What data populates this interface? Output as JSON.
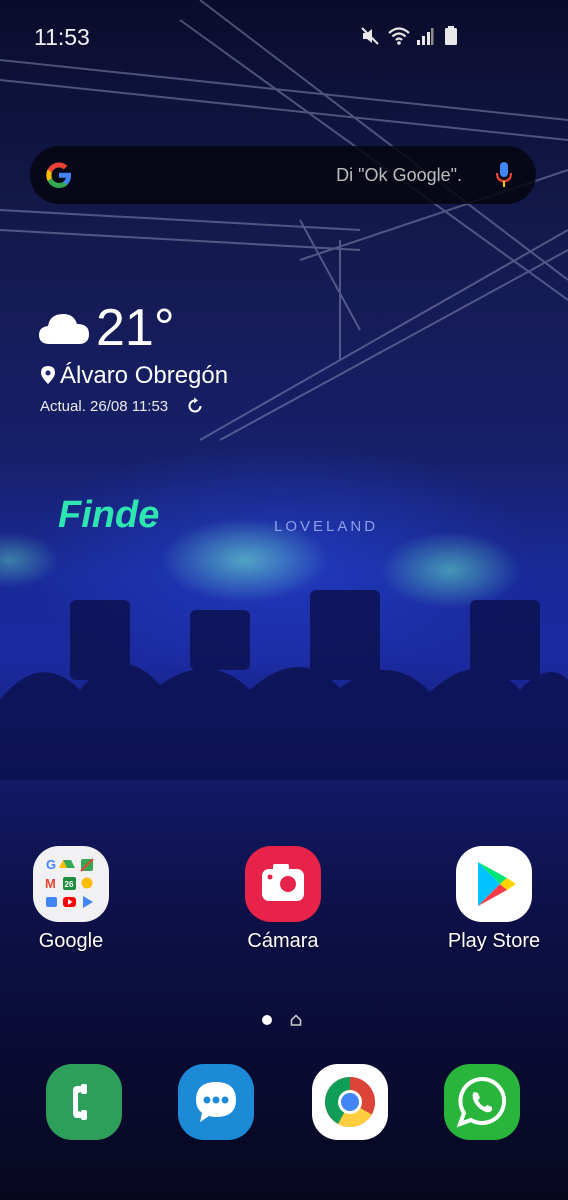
{
  "status_bar": {
    "time": "11:53",
    "icons": [
      "mute-icon",
      "wifi-icon",
      "signal-icon",
      "battery-icon"
    ]
  },
  "search": {
    "placeholder": "Di \"Ok Google\".",
    "logo": "google-g-icon",
    "mic": "mic-icon"
  },
  "weather": {
    "temperature": "21°",
    "condition_icon": "cloud-icon",
    "location": "Álvaro Obregón",
    "updated": "Actual. 26/08 11:53"
  },
  "wallpaper": {
    "banner": "Finde",
    "sub_banner": "LOVELAND"
  },
  "apps": [
    {
      "label": "Google",
      "icon": "google-folder-icon"
    },
    {
      "label": "Cámara",
      "icon": "camera-icon",
      "color": "#e8234a"
    },
    {
      "label": "Play Store",
      "icon": "play-store-icon"
    }
  ],
  "pages": {
    "current": 1,
    "count": 2
  },
  "dock": [
    {
      "icon": "phone-icon",
      "color": "#2e9e5b"
    },
    {
      "icon": "messages-icon",
      "color": "#1d8ad8"
    },
    {
      "icon": "chrome-icon"
    },
    {
      "icon": "whatsapp-icon",
      "color": "#29b43c"
    }
  ]
}
